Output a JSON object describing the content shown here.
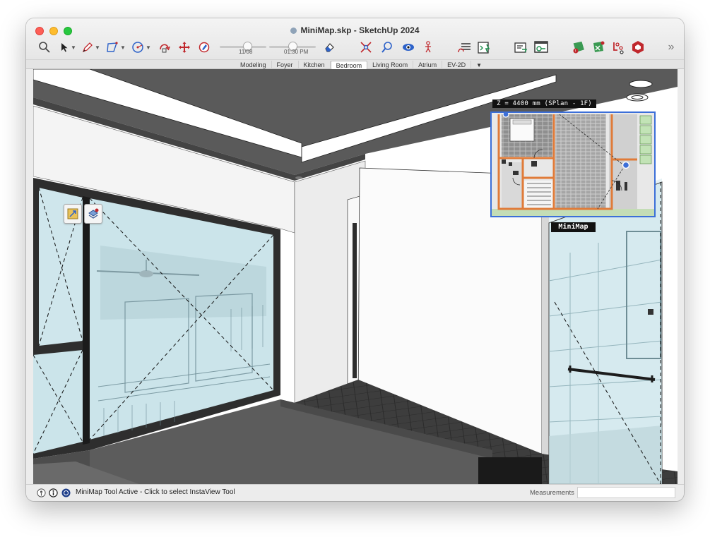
{
  "window": {
    "title": "MiniMap.skp - SketchUp 2024"
  },
  "toolbar": {
    "date_value": "11/08",
    "time_value": "01:30 PM",
    "date_position": 0.62,
    "time_position": 0.5,
    "overflow_label": "»",
    "tools": [
      "zoom-icon",
      "select-arrow-icon",
      "pencil-icon",
      "shape-icon",
      "circle-icon",
      "push-pull-icon",
      "move-icon",
      "paint-icon",
      "eraser-icon",
      "zoom-extents-icon",
      "search-icon",
      "eye-icon",
      "walk-icon",
      "layers-icon",
      "ruby-console-icon",
      "terminal-icon",
      "display-icon",
      "extension-1-icon",
      "extension-2-icon",
      "extension-3-icon",
      "extension-4-icon"
    ]
  },
  "scenes": {
    "tabs": [
      "Modeling",
      "Foyer",
      "Kitchen",
      "Bedroom",
      "Living Room",
      "Atrium",
      "EV-2D"
    ],
    "active": "Bedroom",
    "more_label": "▼"
  },
  "minimap": {
    "z_label": "Z = 4400 mm (SPlan - 1F)",
    "title_label": "MiniMap"
  },
  "statusbar": {
    "message": "MiniMap Tool Active - Click to select InstaView Tool",
    "measurements_label": "Measurements",
    "measurements_value": ""
  },
  "colors": {
    "accent_blue": "#3c6fd8",
    "minimap_wall": "#e07b39",
    "glass": "#cfe8ee",
    "ceiling": "#5a5a5a"
  }
}
